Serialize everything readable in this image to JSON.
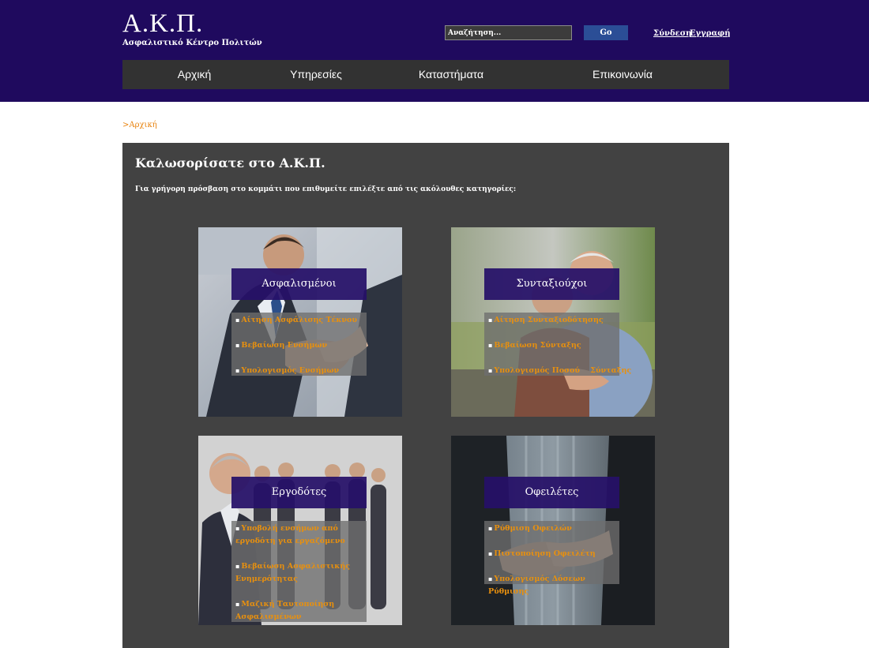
{
  "header": {
    "logo_title": "Α.Κ.Π.",
    "logo_subtitle": "Ασφαλιστικό Κέντρο Πολιτών",
    "search_placeholder": "Αναζήτηση...",
    "go_label": "Go",
    "login_label": "Σύνδεση",
    "register_label": "Εγγραφή"
  },
  "nav": {
    "items": [
      {
        "label": "Αρχική"
      },
      {
        "label": "Υπηρεσίες"
      },
      {
        "label": "Καταστήματα"
      },
      {
        "label": "Επικοινωνία"
      }
    ]
  },
  "breadcrumb": ">Αρχική",
  "main": {
    "title": "Καλωσορίσατε στο Α.Κ.Π.",
    "intro": "Για γρήγορη πρόσβαση στο κομμάτι που επιθυμείτε επιλέξτε από τις ακόλουθες κατηγορίες:"
  },
  "cards": [
    {
      "title": "Ασφαλισμένοι",
      "links": [
        "Αίτηση Ασφάλισης Τέκνου",
        "Βεβαίωση Ενσήμων",
        "Υπολογισμός Ενσήμων"
      ]
    },
    {
      "title": "Συνταξιούχοι",
      "links": [
        "Αίτηση Συνταξιοδότησης",
        "Βεβαίωση Σύνταξης",
        "Υπολογισμός Ποσού    Σύνταξης"
      ]
    },
    {
      "title": "Εργοδότες",
      "links": [
        "Υποβολή ενσήμων από εργοδότη για εργαζόμενο",
        "Βεβαίωση Ασφαλιστικής Ενημερότητας",
        "Μαζική Ταυτοποίηση Ασφαλισμένων"
      ]
    },
    {
      "title": "Οφειλέτες",
      "links": [
        "Ρύθμιση Οφειλών",
        "Πιστοποίηση Οφειλέτη",
        "Υπολογισμός Δόσεων Ρύθμισης"
      ]
    }
  ],
  "colors": {
    "header_bg": "#1f0a5e",
    "nav_bg": "#323232",
    "content_bg": "#424242",
    "accent": "#e8820c",
    "go_button": "#2b4e96"
  }
}
